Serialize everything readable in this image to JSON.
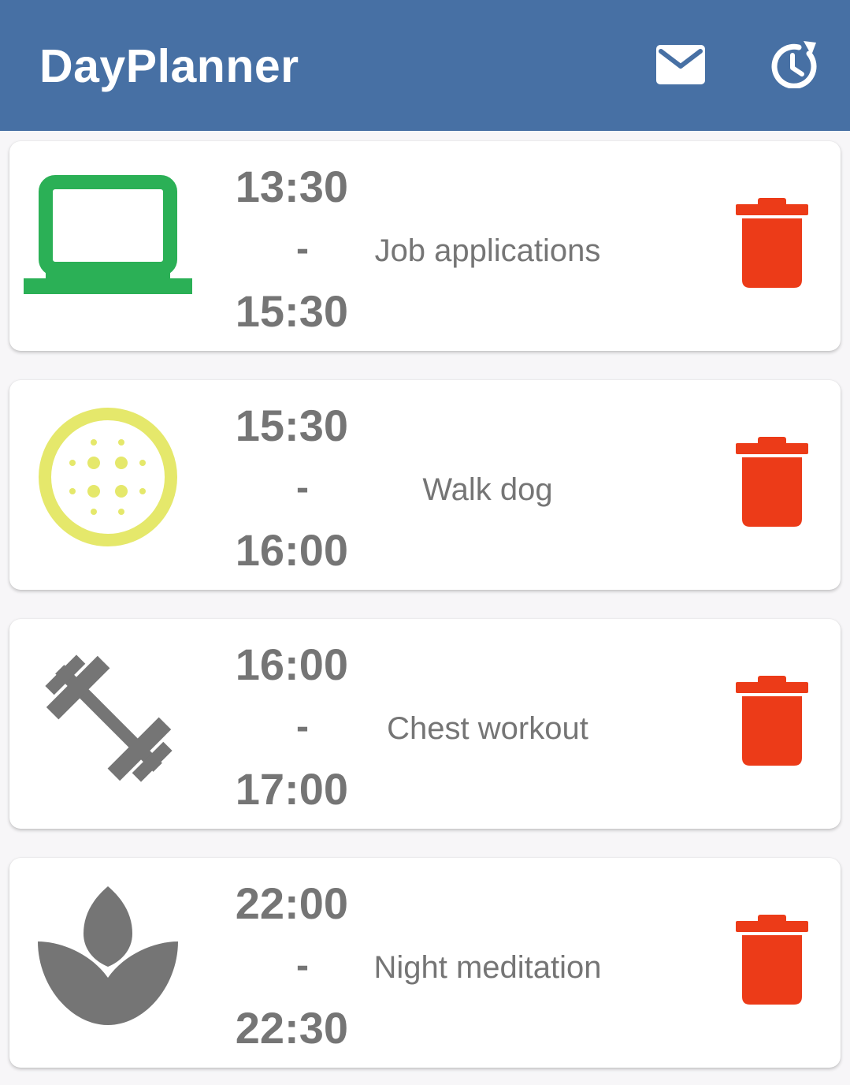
{
  "app": {
    "title": "DayPlanner",
    "actions": [
      {
        "name": "mail-icon"
      },
      {
        "name": "history-icon"
      }
    ]
  },
  "colors": {
    "appbar": "#4770a4",
    "delete": "#ec3b18",
    "text": "#757575",
    "laptop": "#2bb056",
    "dog_ball": "#e5e86b",
    "gray_icon": "#757575"
  },
  "tasks": [
    {
      "start": "13:30",
      "separator": "-",
      "end": "15:30",
      "title": "Job applications",
      "icon": "laptop-icon"
    },
    {
      "start": "15:30",
      "separator": "-",
      "end": "16:00",
      "title": "Walk dog",
      "icon": "tennis-ball-icon"
    },
    {
      "start": "16:00",
      "separator": "-",
      "end": "17:00",
      "title": "Chest workout",
      "icon": "dumbbell-icon"
    },
    {
      "start": "22:00",
      "separator": "-",
      "end": "22:30",
      "title": "Night meditation",
      "icon": "lotus-icon"
    }
  ]
}
